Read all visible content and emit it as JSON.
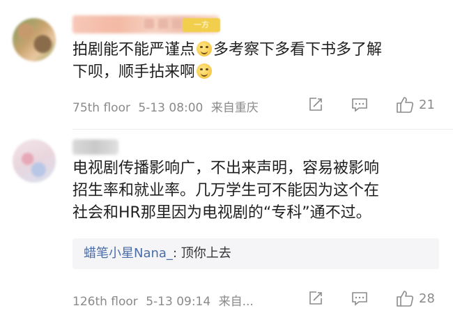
{
  "comments": [
    {
      "content_lines": [
        "拍剧能不能严谨点",
        "多考察下多看下书多了解",
        "下呗，顺手拈来啊"
      ],
      "floor": "75th floor",
      "date": "5-13 08:00",
      "location": "来自重庆",
      "likes": "21"
    },
    {
      "content_lines": [
        "电视剧传播影响广，不出来声明，容易被影响",
        "招生率和就业率。几万学生可不能因为这个在",
        "社会和HR那里因为电视剧的“专科”通不过。"
      ],
      "reply": {
        "user": "蜡笔小星Nana_",
        "separator": ": ",
        "text": "顶你上去"
      },
      "floor": "126th floor",
      "date": "5-13 09:14",
      "location": "来自...",
      "likes": "28"
    }
  ],
  "badge_text": "一方",
  "icons": {
    "share": "share-icon",
    "comment": "comment-icon",
    "like": "thumbs-up-icon",
    "emoji": "smiley-emoji"
  },
  "colors": {
    "reply_user": "#4a6da7",
    "meta_text": "#8a8a8a",
    "reply_bg": "#f5f5f7"
  }
}
